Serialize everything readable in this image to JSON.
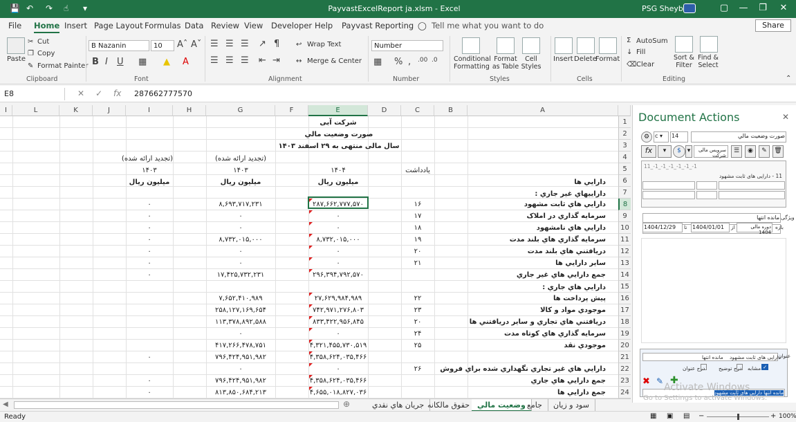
{
  "window": {
    "title": "PayvastExcelReport ja.xlsm  -  Excel",
    "user": "PSG Sheybani"
  },
  "menu": [
    "File",
    "Home",
    "Insert",
    "Page Layout",
    "Formulas",
    "Data",
    "Review",
    "View",
    "Developer",
    "Help",
    "Payvast Reporting"
  ],
  "tell_me": "Tell me what you want to do",
  "share": "Share",
  "ribbon": {
    "clipboard": {
      "label": "Clipboard",
      "paste": "Paste",
      "cut": "Cut",
      "copy": "Copy",
      "format_painter": "Format Painter"
    },
    "font": {
      "label": "Font",
      "name": "B Nazanin",
      "size": "10"
    },
    "alignment": {
      "label": "Alignment",
      "wrap": "Wrap Text",
      "merge": "Merge & Center"
    },
    "number": {
      "label": "Number",
      "format": "Number"
    },
    "styles": {
      "label": "Styles",
      "conditional": "Conditional Formatting",
      "format_table": "Format as Table",
      "cell_styles": "Cell Styles"
    },
    "cells": {
      "label": "Cells",
      "insert": "Insert",
      "delete": "Delete",
      "format": "Format"
    },
    "editing": {
      "label": "Editing",
      "autosum": "AutoSum",
      "fill": "Fill",
      "clear": "Clear",
      "sort": "Sort & Filter",
      "find": "Find & Select"
    }
  },
  "formula_bar": {
    "name_box": "E8",
    "value": "287662777570"
  },
  "columns": [
    "I",
    "L",
    "K",
    "J",
    "I",
    "H",
    "G",
    "F",
    "E",
    "D",
    "C",
    "B",
    "A"
  ],
  "rows": [
    "1",
    "2",
    "3",
    "4",
    "5",
    "6",
    "7",
    "8",
    "9",
    "10",
    "11",
    "12",
    "13",
    "14",
    "15",
    "16",
    "17",
    "18",
    "19",
    "20",
    "21",
    "22",
    "23",
    "24"
  ],
  "sheet": {
    "r1_E": "شرکت آبی",
    "r2_E": "صورت وضعيت مالي",
    "r3_E": "سال مالی منتهی به ۲۹ اسفند ۱۴۰۳",
    "r4_I": "(تجدید ارائه شده)",
    "r4_G": "(تجدید ارائه شده)",
    "r5_I": "۱۴۰۳",
    "r5_G": "۱۴۰۳",
    "r5_E": "۱۴۰۴",
    "r5_C": "يادداشت",
    "r6_I": "ميليون ريال",
    "r6_G": "ميليون ريال",
    "r6_E": "ميليون ريال",
    "r6_A": "دارايي ها",
    "r7_A": "داراييهاي غير جاري :",
    "r8": [
      "۰",
      "۸,۶۹۳,۷۱۷,۲۳۱",
      "۲۸۷,۶۶۲,۷۷۷,۵۷۰",
      "۱۶",
      "دارايي هاي ثابت مشهود"
    ],
    "r9": [
      "۰",
      "۰",
      "۰",
      "۱۷",
      "سرمايه گذاري در املاک"
    ],
    "r10": [
      "۰",
      "۰",
      "۰",
      "۱۸",
      "دارايي هاي نامشهود"
    ],
    "r11": [
      "۰",
      "۸,۷۳۲,۰۱۵,۰۰۰",
      "۸,۷۳۲,۰۱۵,۰۰۰",
      "۱۹",
      "سرمايه گذاري هاي بلند مدت"
    ],
    "r12": [
      "۰",
      "۰",
      "۰",
      "۲۰",
      "دريافتني هاي بلند مدت"
    ],
    "r13": [
      "۰",
      "۰",
      "۰",
      "۲۱",
      "ساير دارايي ها"
    ],
    "r14": [
      "۰",
      "۱۷,۴۲۵,۷۳۲,۲۳۱",
      "۲۹۶,۳۹۴,۷۹۲,۵۷۰",
      "",
      "جمع دارايي هاي غير جاري"
    ],
    "r15_A": "دارايي هاي جاري :",
    "r16": [
      "",
      "۷,۶۵۲,۴۱۰,۹۸۹",
      "۲۷,۶۲۹,۹۸۴,۹۸۹",
      "۲۲",
      "پيش پرداخت ها"
    ],
    "r17": [
      "",
      "۲۵۸,۱۲۷,۱۶۹,۶۵۴",
      "۷۴۲,۹۷۱,۲۷۶,۸۰۳",
      "۲۳",
      "موجودي مواد و کالا"
    ],
    "r18": [
      "",
      "۱۱۳,۳۷۸,۸۹۲,۵۸۸",
      "۸۳۳,۴۲۲,۹۵۶,۸۴۵",
      "۲۰",
      "دريافتني هاي تجاري و ساير دريافتني ها"
    ],
    "r19": [
      "",
      "۰",
      "۰",
      "۲۴",
      "سرمايه گذاري هاي کوتاه مدت"
    ],
    "r20": [
      "",
      "۴۱۷,۲۶۶,۴۷۸,۷۵۱",
      "۴,۳۲۱,۴۵۵,۷۳۰,۵۱۹",
      "۲۵",
      "موجودي نقد"
    ],
    "r21": [
      "۰",
      "۷۹۶,۴۲۴,۹۵۱,۹۸۲",
      "۴,۳۵۸,۶۲۴,۰۳۵,۴۶۶",
      "",
      ""
    ],
    "r22": [
      "",
      "۰",
      "۰",
      "۲۶",
      "دارايي هاي غير تجاري نگهداري شده براي فروش"
    ],
    "r23": [
      "۰",
      "۷۹۶,۴۲۴,۹۵۱,۹۸۲",
      "۴,۳۵۸,۶۲۴,۰۳۵,۴۶۶",
      "",
      "جمع دارايي هاي  جاري"
    ],
    "r24": [
      "۰",
      "۸۱۳,۸۵۰,۶۸۴,۲۱۳",
      "۴,۶۵۵,۰۱۸,۸۲۷,۰۳۶",
      "",
      "جمع دارايي ها"
    ]
  },
  "doc_actions": {
    "title": "Document Actions",
    "font_size": "14",
    "report_title": "صورت وضعيت مالي",
    "company_combo": "سرویس مالی شرکت",
    "code": "11_-1_-1_-1_-1_-1_-1",
    "selected_item": "11 - دارایی های ثابت مشهود",
    "property_label": "ویژگی",
    "property_value": "مانده انتها",
    "period_label": "بازه",
    "period_value": "دوره مالی 1404",
    "from_label": "از",
    "from_date": "1404/01/01",
    "to_label": "تا",
    "to_date": "1404/12/29",
    "title_label": "عنوان",
    "title_value1": "مانده انتها",
    "title_value2": "دارایی های ثابت مشهود",
    "check_similar": "مشابه",
    "check_desc": "درج توضیح",
    "check_title": "درج عنوان",
    "footer_text": "مانده انتها دارایی های ثابت مشهود"
  },
  "sheet_tabs": [
    "سود و زيان",
    "جامع",
    "وضعيت مالي",
    "حقوق مالكانه",
    "جريان هاي نقدي"
  ],
  "active_tab": "وضعيت مالي",
  "status": {
    "left": "Ready",
    "zoom": "100%"
  },
  "watermark": {
    "line1": "Activate Windows",
    "line2": "Go to Settings to activate Windows."
  }
}
